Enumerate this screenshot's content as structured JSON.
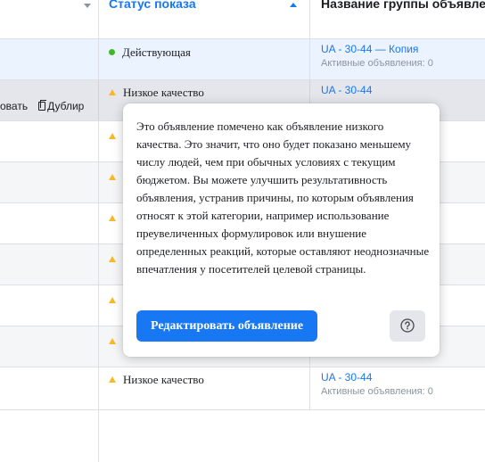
{
  "header": {
    "status_col": "Статус показа",
    "adset_col": "Название группы объявлений"
  },
  "row_actions": {
    "edit_partial": "овать",
    "duplicate_partial": "Дублир"
  },
  "rows": [
    {
      "status": "Действующая",
      "adset": "UA - 30-44 — Копия",
      "active_ads": "Активные объявления: 0"
    },
    {
      "status": "Низкое качество",
      "adset": "UA - 30-44",
      "active_ads": ""
    },
    {
      "status": "Низкое качество",
      "adset": "UA - 30-44",
      "active_ads": "Активные объявления: 0"
    }
  ],
  "popover": {
    "text": "Это объявление помечено как объявление низкого качества. Это значит, что оно будет показано меньшему числу людей, чем при обычных условиях с текущим бюджетом. Вы можете улучшить результативность объявления, устранив причины, по которым объявления относят к этой категории, например использование преувеличенных формулировок или внушение определенных реакций, которые оставляют неоднозначные впечатления у посетителей целевой страницы.",
    "edit_button": "Редактировать объявление"
  },
  "colors": {
    "accent": "#1877f2",
    "active_dot": "#42b72a",
    "warning": "#f7b928",
    "muted": "#8d949e"
  },
  "icons": [
    "chevron-down-icon",
    "sort-up-icon",
    "status-dot-icon",
    "warning-triangle-icon",
    "duplicate-icon",
    "help-icon"
  ]
}
